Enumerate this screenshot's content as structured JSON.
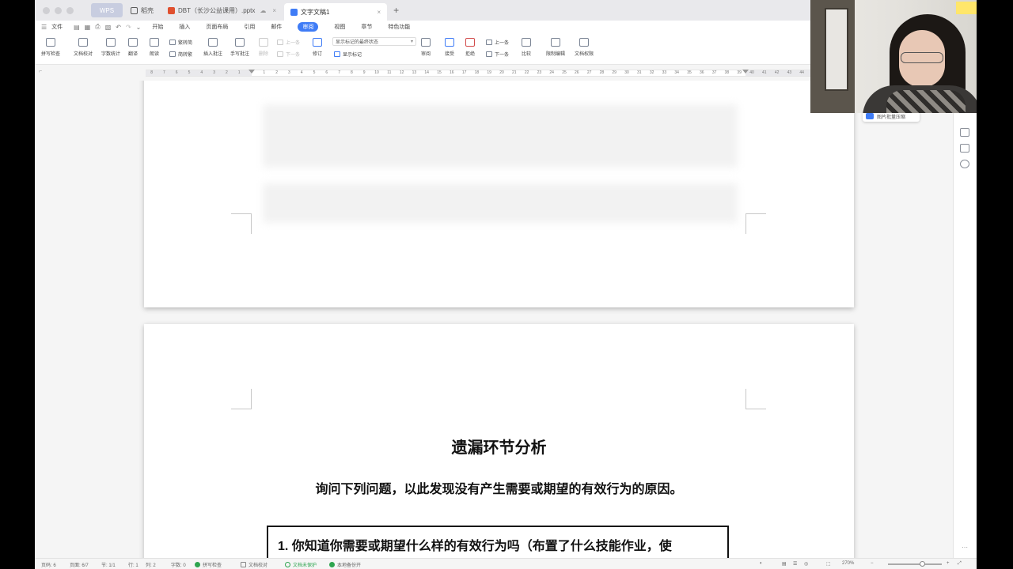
{
  "titlebar": {
    "wps_tab": "WPS",
    "tabs": [
      {
        "label": "稻壳",
        "icon": "daoke-icon",
        "color": "#5a5a5a",
        "active": false
      },
      {
        "label": "DBT（长沙公益课用）.pptx",
        "icon": "pptx-icon",
        "color": "#e0502f",
        "active": false
      },
      {
        "label": "文字文稿1",
        "icon": "doc-icon",
        "color": "#3f7cf6",
        "active": true
      }
    ],
    "new_tab": "+"
  },
  "menubar": {
    "file": "文件",
    "items": [
      "开始",
      "插入",
      "页面布局",
      "引用",
      "邮件",
      "审阅",
      "视图",
      "章节",
      "特色功能"
    ],
    "active_index": 5
  },
  "ribbon": {
    "spell_check": "拼写检查",
    "doc_proof": "文档校对",
    "word_count": "字数统计",
    "translate": "翻译",
    "read_aloud": "朗读",
    "trad_to_simp": "繁转简",
    "simp_to_trad": "简转繁",
    "insert_comment": "插入批注",
    "handwritten_comment": "手写批注",
    "delete": "删除",
    "prev_comment": "上一条",
    "next_comment": "下一条",
    "revise": "修订",
    "markup_view": "显示标记的最终状态",
    "show_markup": "显示标记",
    "review": "审阅",
    "accept": "接受",
    "reject": "拒绝",
    "prev_change": "上一条",
    "next_change": "下一条",
    "compare": "比较",
    "restrict_edit": "限制编辑",
    "doc_permission": "文档权限"
  },
  "ruler": {
    "left_ticks": [
      "8",
      "7",
      "6",
      "5",
      "4",
      "3",
      "2",
      "1"
    ],
    "right_ticks": [
      "1",
      "2",
      "3",
      "4",
      "5",
      "6",
      "7",
      "8",
      "9",
      "10",
      "11",
      "12",
      "13",
      "14",
      "15",
      "16",
      "17",
      "18",
      "19",
      "20",
      "21",
      "22",
      "23",
      "24",
      "25",
      "26",
      "27",
      "28",
      "29",
      "30",
      "31",
      "32",
      "33",
      "34",
      "35",
      "36",
      "37",
      "38",
      "39",
      "40",
      "41",
      "42",
      "43",
      "44"
    ]
  },
  "document": {
    "slide_title": "遗漏环节分析",
    "slide_subtitle": "询问下列问题，以此发现没有产生需要或期望的有效行为的原因。",
    "question_1": "1. 你知道你需要或期望什么样的有效行为吗（布置了什么技能作业，使"
  },
  "sidebar": {
    "compress_chip": "图片批量压缩"
  },
  "statusbar": {
    "page_num": "页码: 6",
    "page_of": "页面: 6/7",
    "section": "节: 1/1",
    "row": "行: 1",
    "col": "列: 2",
    "word_count": "字数: 0",
    "spell_check": "拼写检查",
    "doc_proof": "文档校对",
    "unprotected": "文档未保护",
    "local_backup": "本地备份开",
    "zoom": "270%",
    "zoom_minus": "−",
    "zoom_plus": "+"
  },
  "colors": {
    "accent": "#3f7cf6",
    "ppt_red": "#e0502f",
    "status_green": "#2ea44f"
  }
}
